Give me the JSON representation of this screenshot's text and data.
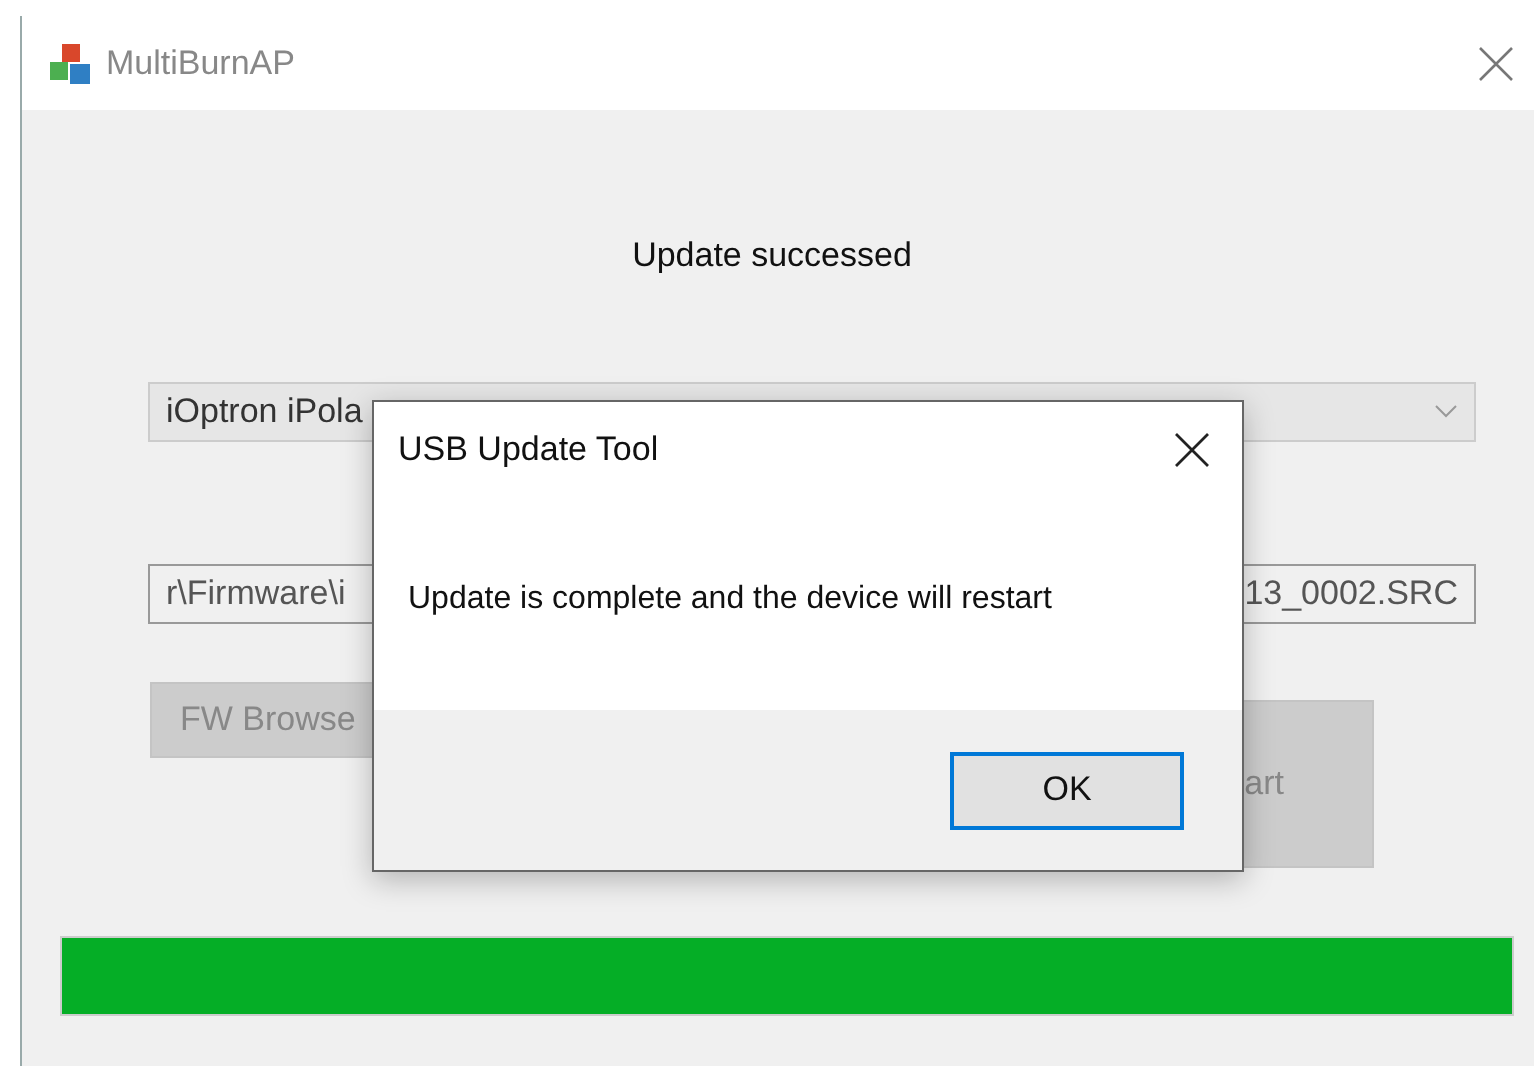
{
  "window": {
    "title": "MultiBurnAP"
  },
  "status": "Update successed",
  "device_select": {
    "value_start": "iOptron iPola"
  },
  "firmware_path": {
    "value_start": "r\\Firmware\\i",
    "value_end": "13_0002.SRC"
  },
  "fw_browse_button": {
    "label": "FW Browse",
    "disabled": true
  },
  "start_button": {
    "label": "art",
    "disabled": true
  },
  "progress": {
    "level": 1
  },
  "dialog": {
    "title": "USB Update Tool",
    "message": "Update is complete and the device will restart",
    "buttons": [
      {
        "label": "OK",
        "selected": true
      }
    ]
  }
}
